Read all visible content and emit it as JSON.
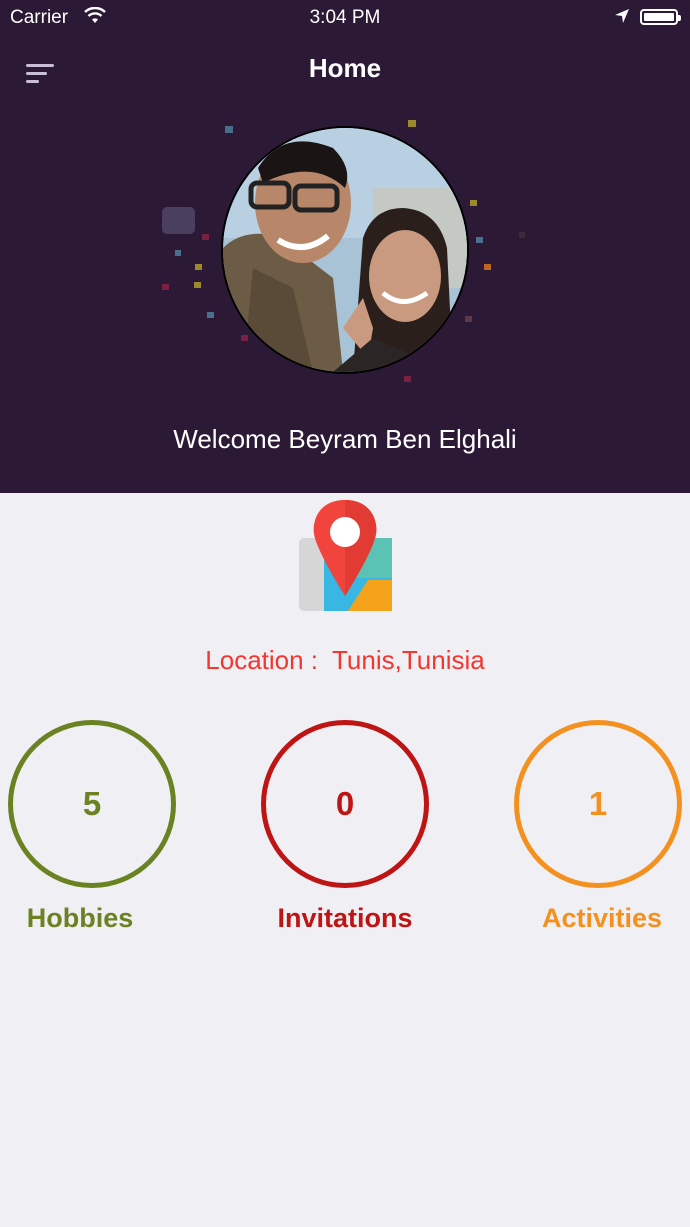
{
  "status_bar": {
    "carrier": "Carrier",
    "time": "3:04 PM"
  },
  "nav": {
    "title": "Home",
    "menu_icon": "menu-icon"
  },
  "profile": {
    "welcome": "Welcome Beyram Ben Elghali"
  },
  "location": {
    "label": "Location :",
    "value": "Tunis,Tunisia",
    "icon": "map-pin-icon",
    "color": "#f4372e"
  },
  "stats": [
    {
      "value": "5",
      "label": "Hobbies",
      "color": "#6b8223"
    },
    {
      "value": "0",
      "label": "Invitations",
      "color": "#bf1414"
    },
    {
      "value": "1",
      "label": "Activities",
      "color": "#f4911e"
    }
  ],
  "colors": {
    "header_bg": "#2c1935",
    "page_bg": "#efeff4"
  }
}
